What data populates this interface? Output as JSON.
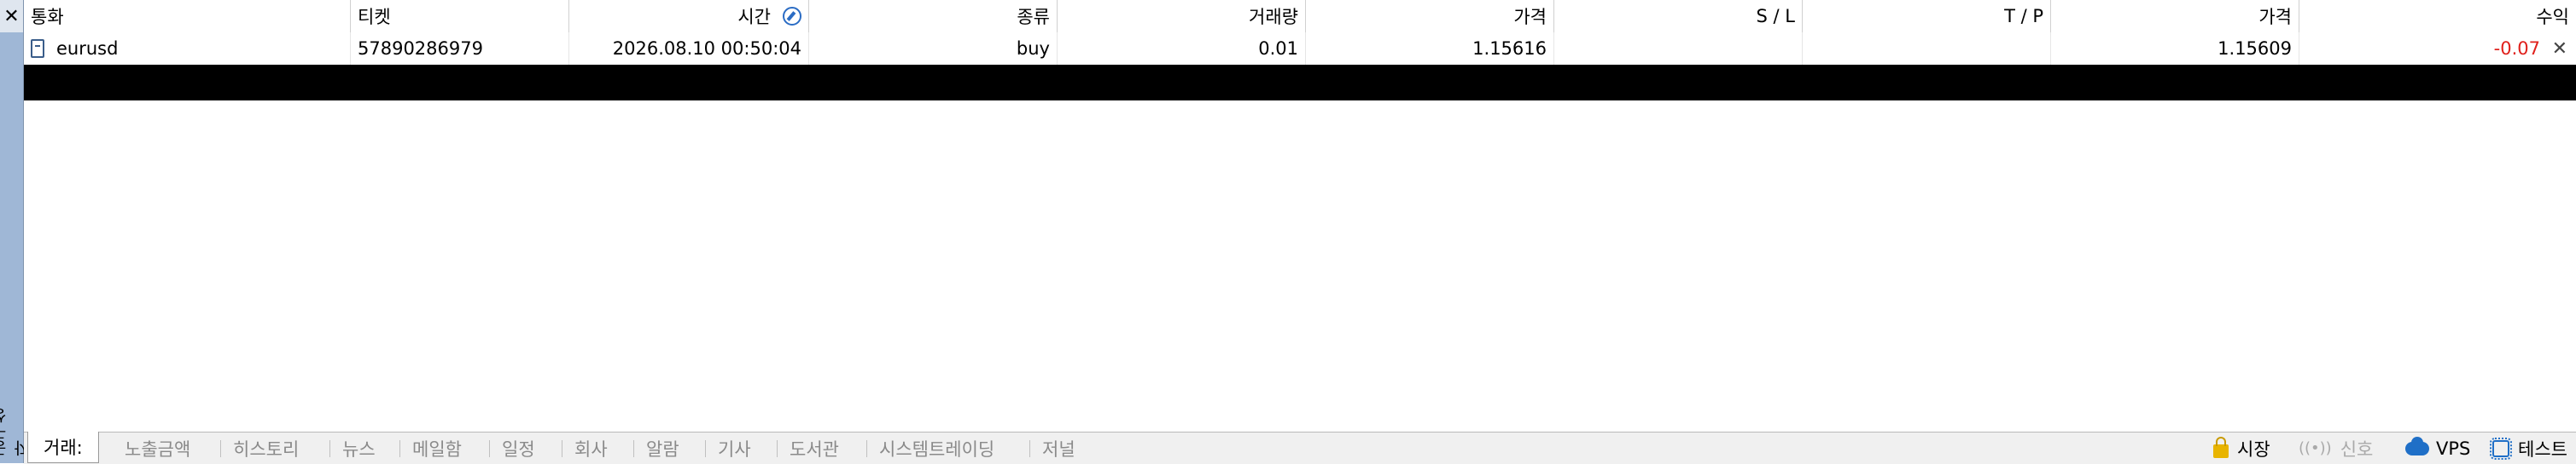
{
  "window": {
    "close_glyph": "✕",
    "side_label": "공구상자"
  },
  "columns": [
    {
      "label": "통화"
    },
    {
      "label": "티켓"
    },
    {
      "label": "시간"
    },
    {
      "label": "종류"
    },
    {
      "label": "거래량"
    },
    {
      "label": "가격"
    },
    {
      "label": "S / L"
    },
    {
      "label": "T / P"
    },
    {
      "label": "가격"
    },
    {
      "label": "수익"
    }
  ],
  "trade_row": {
    "symbol": "eurusd",
    "ticket": "57890286979",
    "time": "2026.08.10 00:50:04",
    "type": "buy",
    "volume": "0.01",
    "open_price": "1.15616",
    "sl": "",
    "tp": "",
    "current_price": "1.15609",
    "profit": "-0.07",
    "close_glyph": "✕"
  },
  "colors": {
    "profit_negative": "#e0201b",
    "accent": "#1f6fc7"
  },
  "tabs": [
    {
      "label": "거래:",
      "active": true
    },
    {
      "label": "노출금액"
    },
    {
      "label": "히스토리"
    },
    {
      "label": "뉴스"
    },
    {
      "label": "메일함"
    },
    {
      "label": "일정"
    },
    {
      "label": "회사"
    },
    {
      "label": "알람"
    },
    {
      "label": "기사"
    },
    {
      "label": "도서관"
    },
    {
      "label": "시스템트레이딩"
    },
    {
      "label": "저널"
    }
  ],
  "status": {
    "market_label": "시장",
    "signal_label": "신호",
    "vps_label": "VPS",
    "test_label": "테스트",
    "icons": [
      "lock-icon",
      "signal-icon",
      "cloud-icon",
      "chip-icon"
    ]
  }
}
